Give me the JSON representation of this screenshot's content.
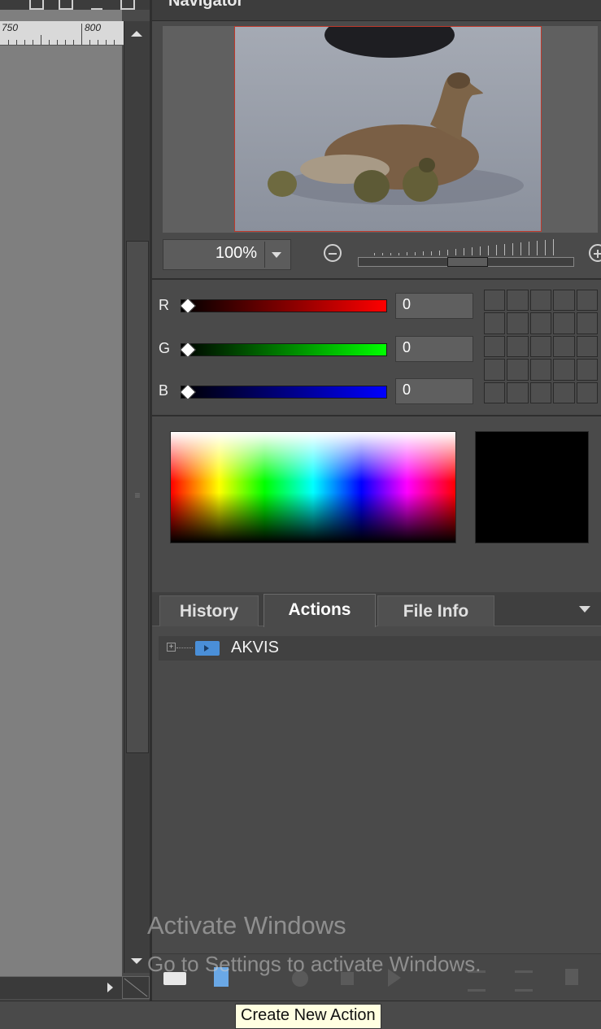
{
  "navigator": {
    "title": "Navigator",
    "zoom_value": "100%"
  },
  "ruler": {
    "labels": [
      "750",
      "800"
    ]
  },
  "channels": [
    {
      "label": "R",
      "value": "0",
      "color": "#ff0000"
    },
    {
      "label": "G",
      "value": "0",
      "color": "#00ff00"
    },
    {
      "label": "B",
      "value": "0",
      "color": "#0000ff"
    }
  ],
  "current_color": "#000000",
  "tabs": [
    {
      "label": "History",
      "active": false
    },
    {
      "label": "Actions",
      "active": true
    },
    {
      "label": "File Info",
      "active": false
    }
  ],
  "actions": {
    "items": [
      {
        "label": "AKVIS",
        "type": "folder"
      }
    ]
  },
  "toolbar": {
    "icons": [
      "new-set-icon",
      "new-action-icon",
      "record-icon",
      "stop-icon",
      "play-icon",
      "insert-stop-icon",
      "insert-menu-icon",
      "delete-icon"
    ]
  },
  "watermark": {
    "line1": "Activate Windows",
    "line2": "Go to Settings to activate Windows."
  },
  "tooltip": {
    "text": "Create New Action"
  },
  "colors": {
    "panel_bg": "#4a4a4a",
    "accent_blue": "#4a8fd8"
  }
}
